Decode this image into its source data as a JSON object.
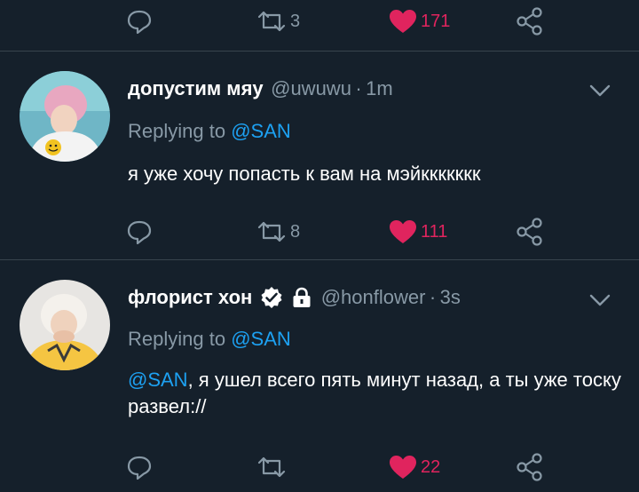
{
  "top_actions": {
    "retweet_count": "3",
    "like_count": "171"
  },
  "tweets": [
    {
      "display_name": "допустим мяу",
      "handle": "@uwuwu",
      "separator": "·",
      "time": "1m",
      "replying_prefix": "Replying to",
      "replying_to": "@SAN",
      "text": "я уже хочу попасть к вам на мэйккккккк",
      "retweet_count": "8",
      "like_count": "111"
    },
    {
      "display_name": "флорист хон",
      "handle": "@honflower",
      "separator": "·",
      "time": "3s",
      "replying_prefix": "Replying to",
      "replying_to": "@SAN",
      "text_mention": "@SAN",
      "text": ", я ушел всего пять минут назад, а ты уже тоску развел://",
      "like_count": "22"
    }
  ],
  "colors": {
    "background": "#15202b",
    "secondary_text": "#8899a6",
    "accent_blue": "#1da1f2",
    "like_red": "#e0245e",
    "divider": "#38444d"
  },
  "icons": [
    "reply-icon",
    "retweet-icon",
    "heart-icon",
    "share-icon",
    "chevron-down-icon",
    "verified-badge-icon",
    "lock-icon"
  ]
}
